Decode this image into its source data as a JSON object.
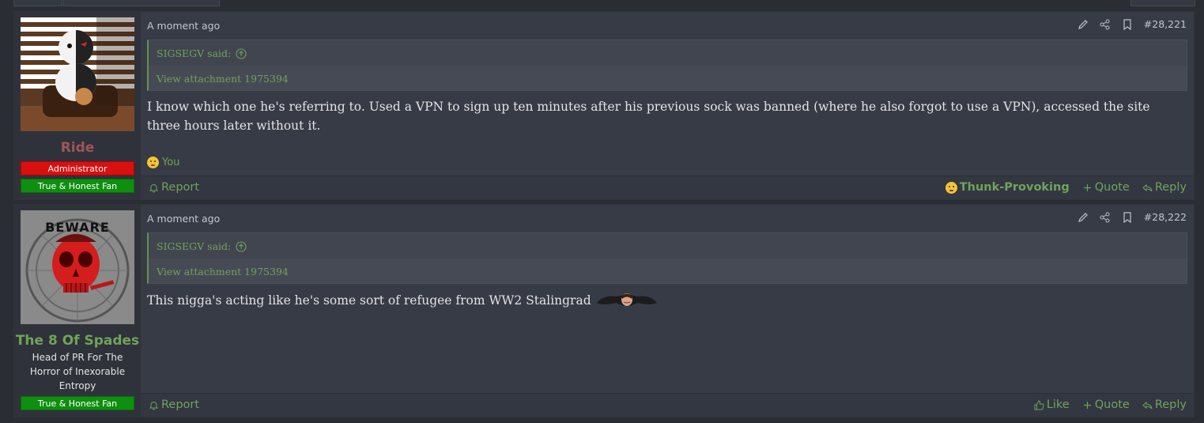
{
  "posts": [
    {
      "username": "Ride",
      "badges": [
        "Administrator",
        "True & Honest Fan"
      ],
      "time": "A moment ago",
      "post_number": "#28,221",
      "quote": {
        "author": "SIGSEGV said:",
        "body": "View attachment 1975394"
      },
      "message": "I know which one he's referring to. Used a VPN to sign up ten minutes after his previous sock was banned (where he also forgot to use a VPN), accessed the site three hours later without it.",
      "reaction_users": "You",
      "footer": {
        "report": "Report",
        "reaction": "Thunk-Provoking",
        "quote": "Quote",
        "reply": "Reply"
      }
    },
    {
      "username": "The 8 Of Spades",
      "custom_title": "Head of PR For The Horror of Inexorable Entropy",
      "badges": [
        "True & Honest Fan"
      ],
      "avatar_text": "BEWARE",
      "time": "A moment ago",
      "post_number": "#28,222",
      "quote": {
        "author": "SIGSEGV said:",
        "body": "View attachment 1975394"
      },
      "message": "This nigga's acting like he's some sort of refugee from WW2 Stalingrad",
      "footer": {
        "report": "Report",
        "like": "Like",
        "quote": "Quote",
        "reply": "Reply"
      }
    }
  ],
  "colors": {
    "accent_green": "#6fa35a",
    "admin_red": "#d81010",
    "fan_green": "#0f8f0f",
    "username_red": "#a05555"
  },
  "icons": [
    "edit-icon",
    "share-icon",
    "bookmark-icon",
    "arrow-up-circle-icon",
    "bell-icon",
    "plus-icon",
    "reply-icon",
    "thumbs-up-icon",
    "thinking-emoji-icon"
  ]
}
